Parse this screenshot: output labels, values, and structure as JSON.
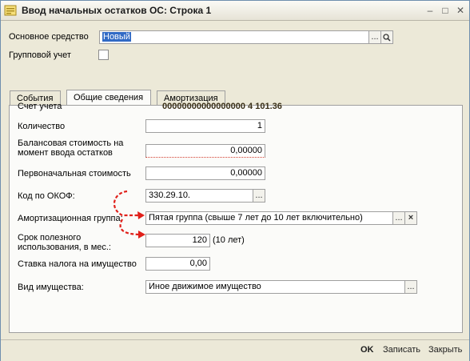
{
  "window": {
    "title": "Ввод начальных остатков ОС: Строка 1"
  },
  "header": {
    "asset_label": "Основное средство",
    "asset_value": "Новый",
    "group_label": "Групповой учет"
  },
  "tabs": [
    {
      "label": "События"
    },
    {
      "label": "Общие сведения"
    },
    {
      "label": "Амортизация"
    }
  ],
  "general": {
    "account_label": "Счет учета",
    "account_value": "00000000000000000  4  101.36",
    "quantity_label": "Количество",
    "quantity_value": "1",
    "balance_label_1": "Балансовая стоимость на",
    "balance_label_2": "момент ввода остатков",
    "balance_value": "0,00000",
    "initial_label": "Первоначальная стоимость",
    "initial_value": "0,00000",
    "okof_label": "Код по ОКОФ:",
    "okof_value": "330.29.10.",
    "amort_group_label": "Амортизационная группа:",
    "amort_group_value": "Пятая группа (свыше 7 лет до 10 лет включительно)",
    "useful_life_label_1": "Срок полезного",
    "useful_life_label_2": "использования, в мес.:",
    "useful_life_value": "120",
    "useful_life_years": "(10 лет)",
    "tax_rate_label": "Ставка налога на имущество",
    "tax_rate_value": "0,00",
    "property_kind_label": "Вид имущества:",
    "property_kind_value": "Иное движимое имущество"
  },
  "footer": {
    "ok": "OK",
    "save": "Записать",
    "close": "Закрыть"
  },
  "colors": {
    "annotation_arrow": "#e0201a",
    "selection": "#316ac5"
  }
}
